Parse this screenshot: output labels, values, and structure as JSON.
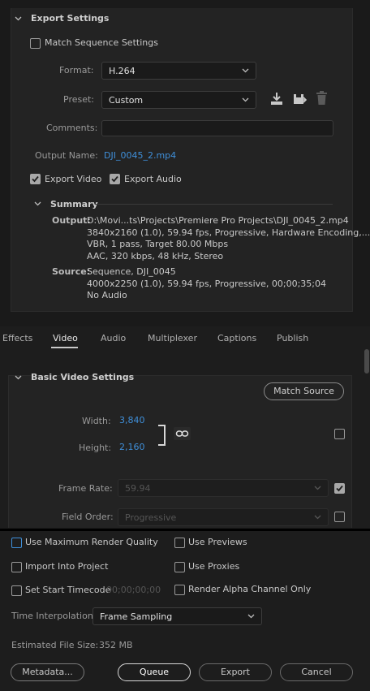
{
  "export_settings": {
    "title": "Export Settings",
    "match_sequence_label": "Match Sequence Settings",
    "format_label": "Format:",
    "format_value": "H.264",
    "preset_label": "Preset:",
    "preset_value": "Custom",
    "comments_label": "Comments:",
    "comments_value": "",
    "output_name_label": "Output Name:",
    "output_name_value": "DJI_0045_2.mp4",
    "export_video_label": "Export Video",
    "export_audio_label": "Export Audio",
    "summary": {
      "title": "Summary",
      "output_label": "Output:",
      "output_lines": [
        "D:\\Movi...ts\\Projects\\Premiere Pro Projects\\DJI_0045_2.mp4",
        "3840x2160 (1.0), 59.94 fps, Progressive, Hardware Encoding,...",
        "VBR, 1 pass, Target 80.00 Mbps",
        "AAC, 320 kbps, 48 kHz, Stereo"
      ],
      "source_label": "Source:",
      "source_lines": [
        "Sequence, DJI_0045",
        "4000x2250 (1.0), 59.94 fps, Progressive, 00;00;35;04",
        "No Audio"
      ]
    }
  },
  "tabs": [
    "Effects",
    "Video",
    "Audio",
    "Multiplexer",
    "Captions",
    "Publish"
  ],
  "active_tab": "Video",
  "video": {
    "section_title": "Basic Video Settings",
    "match_source_label": "Match Source",
    "width_label": "Width:",
    "width_value": "3,840",
    "height_label": "Height:",
    "height_value": "2,160",
    "frame_rate_label": "Frame Rate:",
    "frame_rate_value": "59.94",
    "field_order_label": "Field Order:",
    "field_order_value": "Progressive"
  },
  "bottom": {
    "use_max_render_quality": "Use Maximum Render Quality",
    "use_previews": "Use Previews",
    "import_into_project": "Import Into Project",
    "use_proxies": "Use Proxies",
    "set_start_timecode": "Set Start Timecode",
    "start_timecode_value": "00;00;00;00",
    "render_alpha_only": "Render Alpha Channel Only",
    "time_interpolation_label": "Time Interpolation:",
    "time_interpolation_value": "Frame Sampling",
    "estimated_size_label": "Estimated File Size:",
    "estimated_size_value": "352 MB",
    "metadata_button": "Metadata...",
    "queue_button": "Queue",
    "export_button": "Export",
    "cancel_button": "Cancel"
  },
  "icons": [
    "chevron-down-icon",
    "import-preset-icon",
    "save-preset-icon",
    "trash-icon",
    "link-icon",
    "check-icon"
  ],
  "colors": {
    "accent": "#3f8fd9",
    "background": "#1d1d1d",
    "panel": "#232323"
  }
}
